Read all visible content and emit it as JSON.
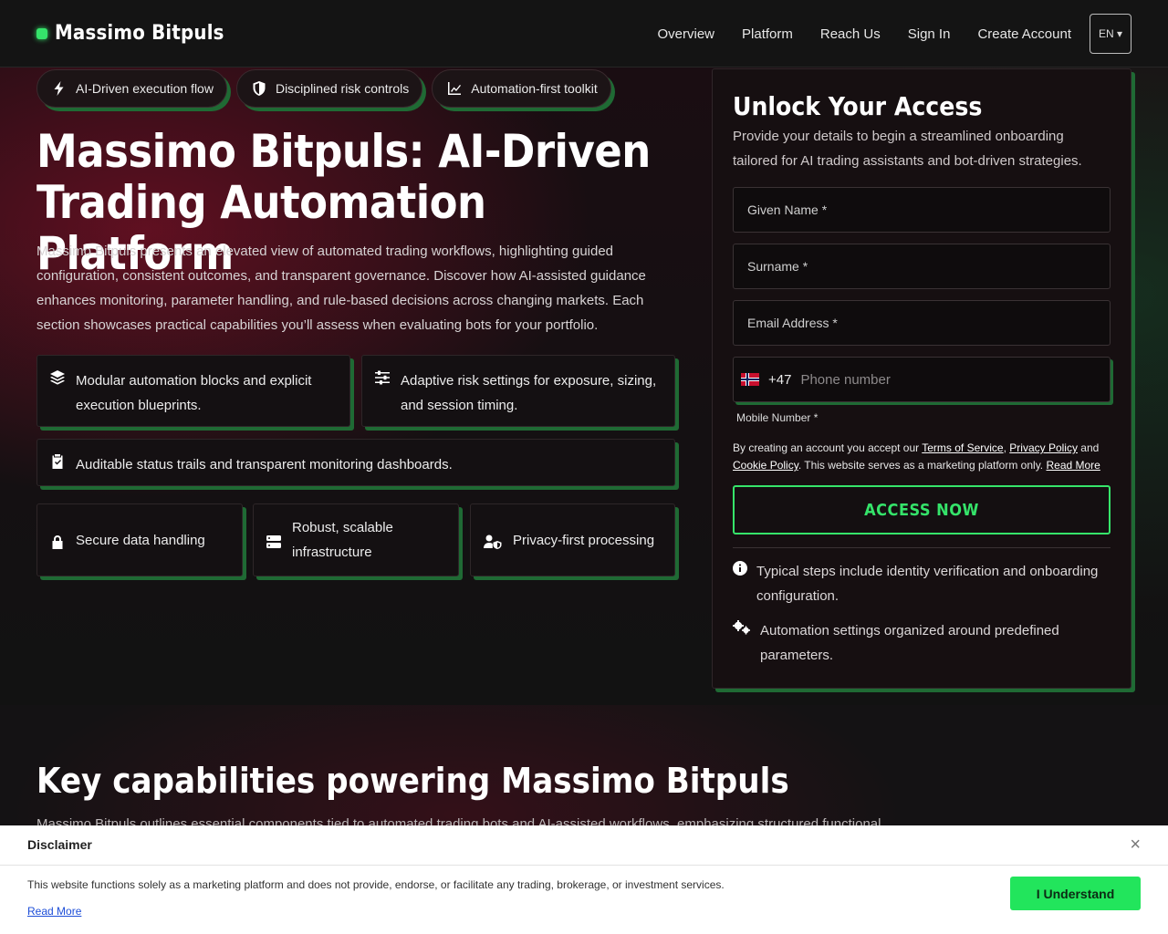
{
  "brand": {
    "name": "Massimo Bitpuls"
  },
  "nav": {
    "items": [
      "Overview",
      "Platform",
      "Reach Us",
      "Sign In",
      "Create Account"
    ],
    "language": "EN ▾"
  },
  "pills": [
    {
      "label": "AI-Driven execution flow",
      "icon": "bolt-icon"
    },
    {
      "label": "Disciplined risk controls",
      "icon": "shield-icon"
    },
    {
      "label": "Automation-first toolkit",
      "icon": "chart-line-icon"
    }
  ],
  "hero": {
    "title": "Massimo Bitpuls: AI-Driven Trading Automation Platform",
    "description": "Massimo Bitpuls presents an elevated view of automated trading workflows, highlighting guided configuration, consistent outcomes, and transparent governance. Discover how AI-assisted guidance enhances monitoring, parameter handling, and rule-based decisions across changing markets. Each section showcases practical ca­pabilities you’ll assess when evaluating bots for your portfolio."
  },
  "features": [
    {
      "text": "Modular automation blocks and explicit execution blueprints.",
      "icon": "layers-icon"
    },
    {
      "text": "Adaptive risk settings for exposure, sizing, and session timing.",
      "icon": "sliders-icon"
    },
    {
      "text": "Auditable status trails and transparent monitoring dashboards.",
      "icon": "clipboard-check-icon"
    }
  ],
  "badges": [
    {
      "text": "Secure data handling",
      "icon": "lock-icon"
    },
    {
      "text": "Robust, scalable infrastructure",
      "icon": "server-icon"
    },
    {
      "text": "Privacy-first processing",
      "icon": "user-shield-icon"
    }
  ],
  "form": {
    "title": "Unlock Your Access",
    "subtitle": "Provide your details to begin a streamlined onboarding tailored for AI trading assistants and bot-driven strategies.",
    "given_name_placeholder": "Given Name *",
    "surname_placeholder": "Surname *",
    "email_placeholder": "Email Address *",
    "dial_code": "+47",
    "phone_placeholder": "Phone number",
    "mobile_label": "Mobile Number *",
    "terms_prefix": "By creating an account you accept our ",
    "terms_link": "Terms of Service",
    "terms_sep1": ", ",
    "privacy_link": "Privacy Policy",
    "terms_and": " and ",
    "cookie_link": "Cookie Policy",
    "terms_suffix": ". This website serves as a marketing platform only. ",
    "read_more": "Read More",
    "submit": "ACCESS NOW",
    "notes": [
      {
        "text": "Typical steps include identity verification and onboarding configuration.",
        "icon": "info-icon"
      },
      {
        "text": "Automation settings organized around predefined parameters.",
        "icon": "gears-icon"
      }
    ]
  },
  "capabilities": {
    "title": "Key capabilities powering Massimo Bitpuls",
    "description": "Massimo Bitpuls outlines essential components tied to automated trading bots and AI-assisted workflows, emphasizing structured functional"
  },
  "disclaimer": {
    "title": "Disclaimer",
    "text": "This website functions solely as a marketing platform and does not provide, endorse, or facilitate any trading, brokerage, or investment services.",
    "link": "Read More",
    "button": "I Understand",
    "close": "×"
  }
}
